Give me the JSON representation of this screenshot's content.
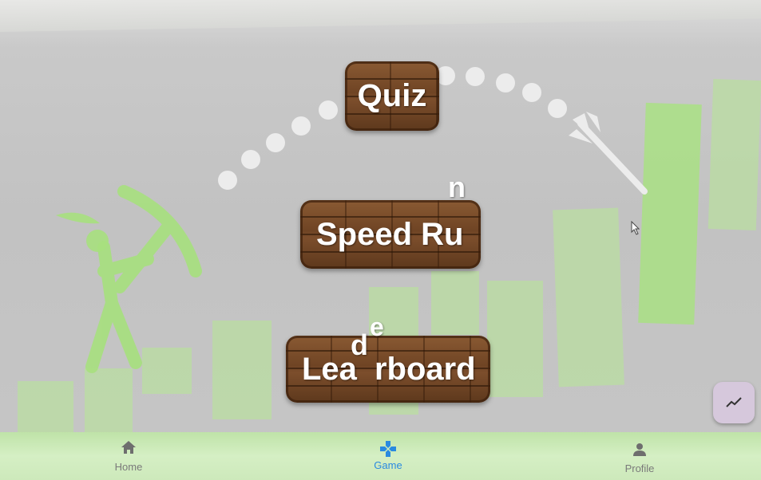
{
  "menu": {
    "quiz_label": "Quiz",
    "speed_run_label": "Speed Ru",
    "speed_run_stray": "n",
    "leaderboard_part1": "Lea",
    "leaderboard_part2": "rboard",
    "leaderboard_stray_d": "d",
    "leaderboard_stray_e": "e"
  },
  "bottom_nav": {
    "items": [
      {
        "label": "Home",
        "icon": "home-icon"
      },
      {
        "label": "Game",
        "icon": "gamepad-icon",
        "active": true
      },
      {
        "label": "Profile",
        "icon": "person-icon"
      }
    ]
  },
  "fab": {
    "icon": "trending-icon"
  },
  "colors": {
    "wood": "#6f4424",
    "accent": "#2a8ae0",
    "nav_bg": "#cde9bb",
    "bar_green": "#a9e184"
  }
}
